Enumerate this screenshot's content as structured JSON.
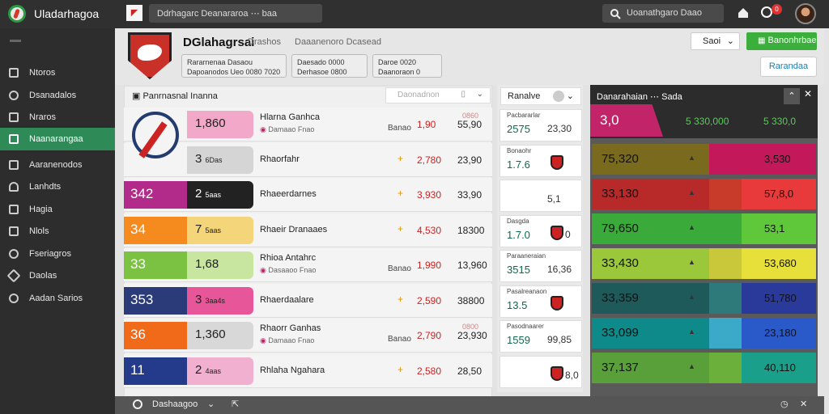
{
  "app": {
    "title": "Uladarhagoa"
  },
  "tab": {
    "label": "Ddrhagarc Deanararoa",
    "extra": "⋯ baa"
  },
  "search": {
    "placeholder": "Uoanathgaro Daao"
  },
  "notifications": {
    "count": "0"
  },
  "sidebar": {
    "items": [
      {
        "label": "Ntoros"
      },
      {
        "label": "Dsanadalos"
      },
      {
        "label": "Nraros"
      },
      {
        "label": "Naanarangaa",
        "active": true
      },
      {
        "label": "Aaranenodos"
      },
      {
        "label": "Lanhdts"
      },
      {
        "label": "Hagia"
      },
      {
        "label": "Nlols"
      },
      {
        "label": "Fseriagros"
      },
      {
        "label": "Daolas"
      },
      {
        "label": "Aadan Sarios"
      }
    ]
  },
  "header": {
    "team_name": "DGlahagrsai",
    "sub1": "Drashos",
    "sub2": "Daaanenoro Dcasead",
    "chips": [
      {
        "l1": "Rararnenaa Dasaou",
        "l2": "Dapoanodos Ueo 0080 7020"
      },
      {
        "l1": "Daesado 0000",
        "l2": "Derhasoe 0800"
      },
      {
        "l1": "Daroe 0020",
        "l2": "Daanoraon 0"
      }
    ],
    "select_label": "Saoi",
    "green_button": "Banonhrbae",
    "outline_button": "Rarandaa"
  },
  "list": {
    "title": "Panrnasnal Inanna",
    "search_placeholder": "Daonadnon",
    "rows": [
      {
        "a": "",
        "b": "1,860",
        "name": "Hlarna Ganhca",
        "sub": "Damaao Fnao",
        "mid": "Banao",
        "plus": "",
        "v1": "1,90",
        "v2": "55,90",
        "v2b": "0860",
        "colA": "#f4f4f4",
        "colB": "#f2a8c8"
      },
      {
        "a": "",
        "b": "3",
        "bsmall": "6Das",
        "name": "Rhaorfahr",
        "sub": "",
        "mid": "",
        "plus": "+",
        "v1": "2,780",
        "v2": "23,90",
        "v2b": "",
        "colA": "#f4f4f4",
        "colB": "#d5d5d5"
      },
      {
        "a": "342",
        "b": "2",
        "bsmall": "5aas",
        "name": "Rhaeerdarnes",
        "sub": "",
        "mid": "",
        "plus": "+",
        "v1": "3,930",
        "v2": "33,90",
        "v2b": "",
        "colA": "#b22b8a",
        "colB": "#222222",
        "bdark": true
      },
      {
        "a": "34",
        "b": "7",
        "bsmall": "5aas",
        "name": "Rhaeir Dranaaes",
        "sub": "",
        "mid": "",
        "plus": "+",
        "v1": "4,530",
        "v2": "18300",
        "v2b": "",
        "colA": "#f58a1f",
        "colB": "#f4d57a"
      },
      {
        "a": "33",
        "b": "1,68",
        "name": "Rhioa Antahrc",
        "sub": "Dasaaoo Fnao",
        "mid": "Banao",
        "plus": "",
        "v1": "1,990",
        "v2": "13,960",
        "v2b": "",
        "colA": "#7cc242",
        "colB": "#c9e6a0"
      },
      {
        "a": "353",
        "b": "3",
        "bsmall": "3aa4s",
        "name": "Rhaerdaalare",
        "sub": "",
        "mid": "",
        "plus": "+",
        "v1": "2,590",
        "v2": "38800",
        "v2b": "",
        "colA": "#2b3a78",
        "colB": "#e8569a"
      },
      {
        "a": "36",
        "b": "1,360",
        "name": "Rhaorr Ganhas",
        "sub": "Damaao Fnao",
        "mid": "Banao",
        "plus": "",
        "v1": "2,790",
        "v2": "23,930",
        "v2b": "0800",
        "colA": "#f06a1a",
        "colB": "#d8d8d8"
      },
      {
        "a": "11",
        "b": "2",
        "bsmall": "4aas",
        "name": "Rhlaha Ngahara",
        "sub": "",
        "mid": "",
        "plus": "+",
        "v1": "2,580",
        "v2": "28,50",
        "v2b": "",
        "colA": "#243a8a",
        "colB": "#f2b0d0"
      }
    ]
  },
  "middle": {
    "header": "Ranalve",
    "cards": [
      {
        "t1": "Pacbararlar",
        "t2": "2575",
        "t3": "23,30"
      },
      {
        "t1": "Bonaohr",
        "t2": "1.7.6",
        "t3": ""
      },
      {
        "t1": "",
        "t2": "",
        "t3": "5,1"
      },
      {
        "t1": "Dasgda",
        "t2": "1.7.0",
        "t3": "0"
      },
      {
        "t1": "Paraaneraian",
        "t2": "3515",
        "t3": "16,36"
      },
      {
        "t1": "Pasalreanaon",
        "t2": "13.5",
        "t3": ""
      },
      {
        "t1": "Pasodnaarer",
        "t2": "1559",
        "t3": "99,85"
      },
      {
        "t1": "",
        "t2": "",
        "t3": "8,0"
      }
    ]
  },
  "right": {
    "title": "Danarahaian ⋯ Sada",
    "top_a": "3,0",
    "top_b": "5 330,000",
    "top_c": "5 330,0",
    "rows": [
      {
        "a": "75,320",
        "c": "3,530",
        "colA": "#7a6a1e",
        "colB": "#c3185a",
        "colC": "#c3185a"
      },
      {
        "a": "33,130",
        "c": "57,8,0",
        "colA": "#b82a2a",
        "colB": "#c83a2a",
        "colC": "#e83a3a"
      },
      {
        "a": "79,650",
        "c": "53,1",
        "colA": "#3aaa3a",
        "colB": "#3aaa3a",
        "colC": "#5ec83a"
      },
      {
        "a": "33,430",
        "c": "53,680",
        "colA": "#9ac83a",
        "colB": "#c8c83a",
        "colC": "#e8e03a"
      },
      {
        "a": "33,359",
        "c": "51,780",
        "colA": "#1e5a5a",
        "colB": "#2e7a7a",
        "colC": "#2a3a9a"
      },
      {
        "a": "33,099",
        "c": "23,180",
        "colA": "#0e8a8a",
        "colB": "#3aaac8",
        "colC": "#2a5aca"
      },
      {
        "a": "37,137",
        "c": "40,110",
        "colA": "#5aa03a",
        "colB": "#6ab03a",
        "colC": "#1aa08a"
      }
    ]
  },
  "footer": {
    "label": "Dashaagoo"
  }
}
